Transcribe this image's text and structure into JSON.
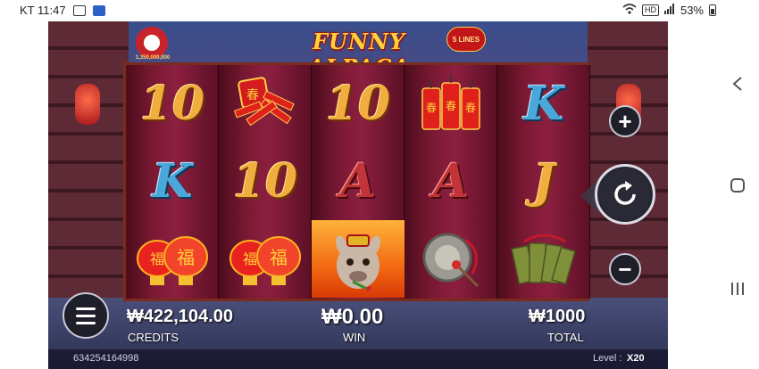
{
  "status_bar": {
    "carrier_time": "KT 11:47",
    "battery": "53%",
    "hd": "HD"
  },
  "game": {
    "title": "FUNNY ALPACA",
    "lines_badge": "5 LINES",
    "jackpot_amount": "1,350,000,000",
    "reels": [
      [
        "10",
        "K",
        "lantern-fu"
      ],
      [
        "firecracker-bundle",
        "10",
        "lantern-fu"
      ],
      [
        "10",
        "A",
        "alpaca-wild"
      ],
      [
        "firecracker-sticks",
        "A",
        "gong"
      ],
      [
        "K",
        "J",
        "jade-tablets"
      ]
    ],
    "credits_value": "₩422,104.00",
    "credits_label": "CREDITS",
    "win_value": "₩0.00",
    "win_label": "WIN",
    "total_value": "₩1000",
    "total_label": "TOTAL",
    "game_id": "634254164998",
    "level_label": "Level :",
    "level_value": "X20"
  },
  "colors": {
    "gold": "#f1ad3e",
    "blue": "#4aa7d9",
    "red": "#c0343a"
  }
}
